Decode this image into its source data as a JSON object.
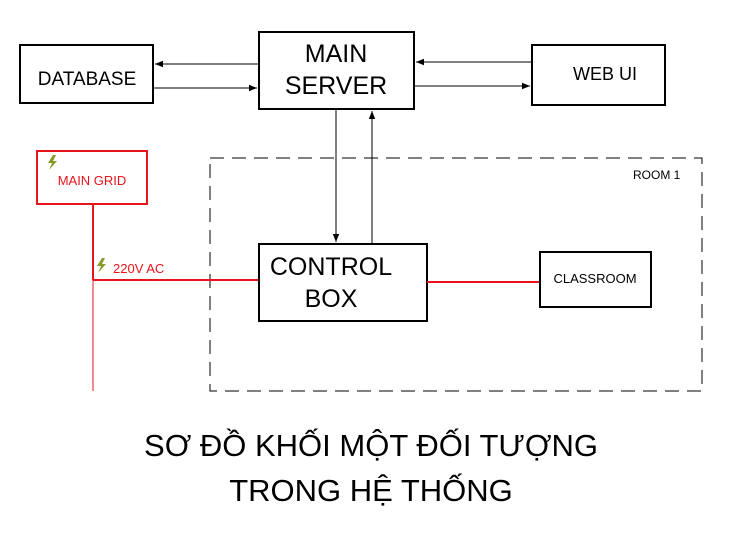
{
  "diagram": {
    "nodes": {
      "database": {
        "label": "DATABASE"
      },
      "main_server": {
        "label_line1": "MAIN",
        "label_line2": "SERVER"
      },
      "web_ui": {
        "label": "WEB UI"
      },
      "main_grid": {
        "label": "MAIN GRID"
      },
      "control_box": {
        "label_line1": "CONTROL",
        "label_line2": "BOX"
      },
      "classroom": {
        "label": "CLASSROOM"
      }
    },
    "room": {
      "label": "ROOM 1"
    },
    "power_label": "220V AC",
    "icons": {
      "power": "lightning-bolt-icon"
    },
    "colors": {
      "power_line": "#e8141c",
      "bolt": "#8a9a2a",
      "line": "#000000"
    }
  },
  "title": {
    "line1": "SƠ ĐỒ KHỐI MỘT ĐỐI TƯỢNG",
    "line2": "TRONG HỆ THỐNG"
  }
}
